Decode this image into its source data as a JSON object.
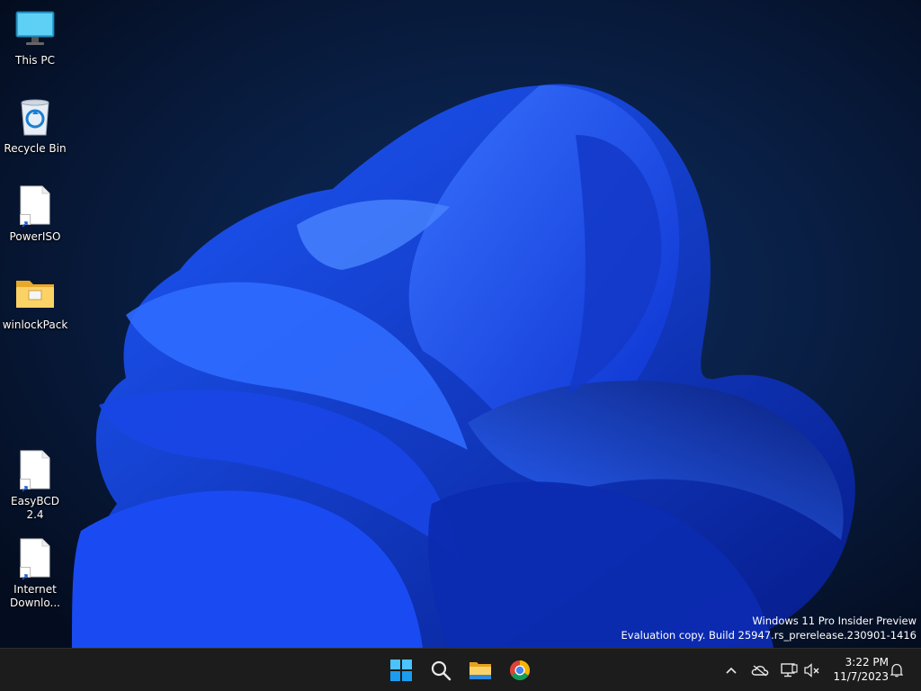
{
  "desktop": {
    "icons": [
      {
        "label": "This PC",
        "icon": "monitor-icon"
      },
      {
        "label": "Recycle Bin",
        "icon": "recycle-bin-icon"
      },
      {
        "label": "PowerISO",
        "icon": "shortcut-file-icon"
      },
      {
        "label": "winlockPack",
        "icon": "folder-icon"
      },
      {
        "label": "EasyBCD 2.4",
        "icon": "shortcut-file-icon"
      },
      {
        "label": "Internet Downlo...",
        "icon": "shortcut-file-icon"
      }
    ],
    "watermark": {
      "line1": "Windows 11 Pro Insider Preview",
      "line2": "Evaluation copy. Build 25947.rs_prerelease.230901-1416"
    }
  },
  "taskbar": {
    "apps": [
      "start-icon",
      "search-icon",
      "file-explorer-icon",
      "chrome-icon"
    ],
    "tray": [
      "chevron-up-icon",
      "onedrive-icon",
      "network-icon",
      "speaker-muted-icon"
    ],
    "clock": {
      "time": "3:22 PM",
      "date": "11/7/2023"
    },
    "notification_icon": "bell-icon"
  },
  "colors": {
    "wallpaper_bg": "#06122a",
    "bloom": "#1f55ff",
    "taskbar": "#1c1c1c",
    "accent": "#0078d4"
  }
}
